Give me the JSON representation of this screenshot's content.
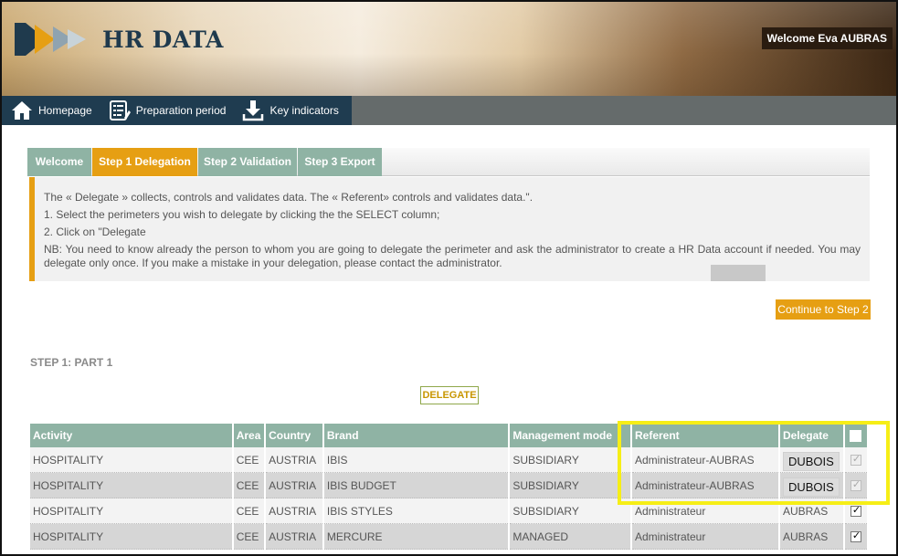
{
  "header": {
    "app_title": "HR DATA",
    "welcome_text": "Welcome Eva AUBRAS"
  },
  "nav": {
    "items": [
      {
        "label": "Homepage",
        "icon": "home-icon"
      },
      {
        "label": "Preparation period",
        "icon": "form-icon"
      },
      {
        "label": "Key indicators",
        "icon": "download-icon"
      }
    ]
  },
  "tabs": [
    {
      "label": "Welcome",
      "active": false
    },
    {
      "label": "Step 1 Delegation",
      "active": true
    },
    {
      "label": "Step 2 Validation",
      "active": false
    },
    {
      "label": "Step 3 Export",
      "active": false
    }
  ],
  "info": {
    "line1": "The « Delegate » collects, controls and validates data. The « Referent» controls and validates data.\".",
    "line2": "1. Select the perimeters you wish to delegate by clicking the the SELECT column;",
    "line3": "2. Click on \"Delegate",
    "nb": "NB: You need to know already the person to whom you are going to delegate the perimeter and ask the administrator to create a HR Data account if needed. You may delegate only once. If you make a mistake in your delegation, please contact the administrator."
  },
  "continue_label": "Continue to Step 2",
  "step_heading": "STEP 1: PART 1",
  "delegate_label": "DELEGATE",
  "table": {
    "headers": {
      "activity": "Activity",
      "area": "Area",
      "country": "Country",
      "brand": "Brand",
      "management_mode": "Management mode",
      "referent": "Referent",
      "delegate": "Delegate"
    },
    "rows": [
      {
        "activity": "HOSPITALITY",
        "area": "CEE",
        "country": "AUSTRIA",
        "brand": "IBIS",
        "management_mode": "SUBSIDIARY",
        "referent": "Administrateur-AUBRAS",
        "delegate": "DUBOIS",
        "checked": true,
        "disabled": true
      },
      {
        "activity": "HOSPITALITY",
        "area": "CEE",
        "country": "AUSTRIA",
        "brand": "IBIS BUDGET",
        "management_mode": "SUBSIDIARY",
        "referent": "Administrateur-AUBRAS",
        "delegate": "DUBOIS",
        "checked": true,
        "disabled": true
      },
      {
        "activity": "HOSPITALITY",
        "area": "CEE",
        "country": "AUSTRIA",
        "brand": "IBIS STYLES",
        "management_mode": "SUBSIDIARY",
        "referent": "Administrateur",
        "delegate": "AUBRAS",
        "checked": true,
        "disabled": false
      },
      {
        "activity": "HOSPITALITY",
        "area": "CEE",
        "country": "AUSTRIA",
        "brand": "MERCURE",
        "management_mode": "MANAGED",
        "referent": "Administrateur",
        "delegate": "AUBRAS",
        "checked": true,
        "disabled": false
      }
    ]
  },
  "colors": {
    "accent_orange": "#e69f13",
    "tab_green": "#8fb3a4",
    "nav_blue": "#1f3c50",
    "highlight_yellow": "#f6ee16"
  }
}
